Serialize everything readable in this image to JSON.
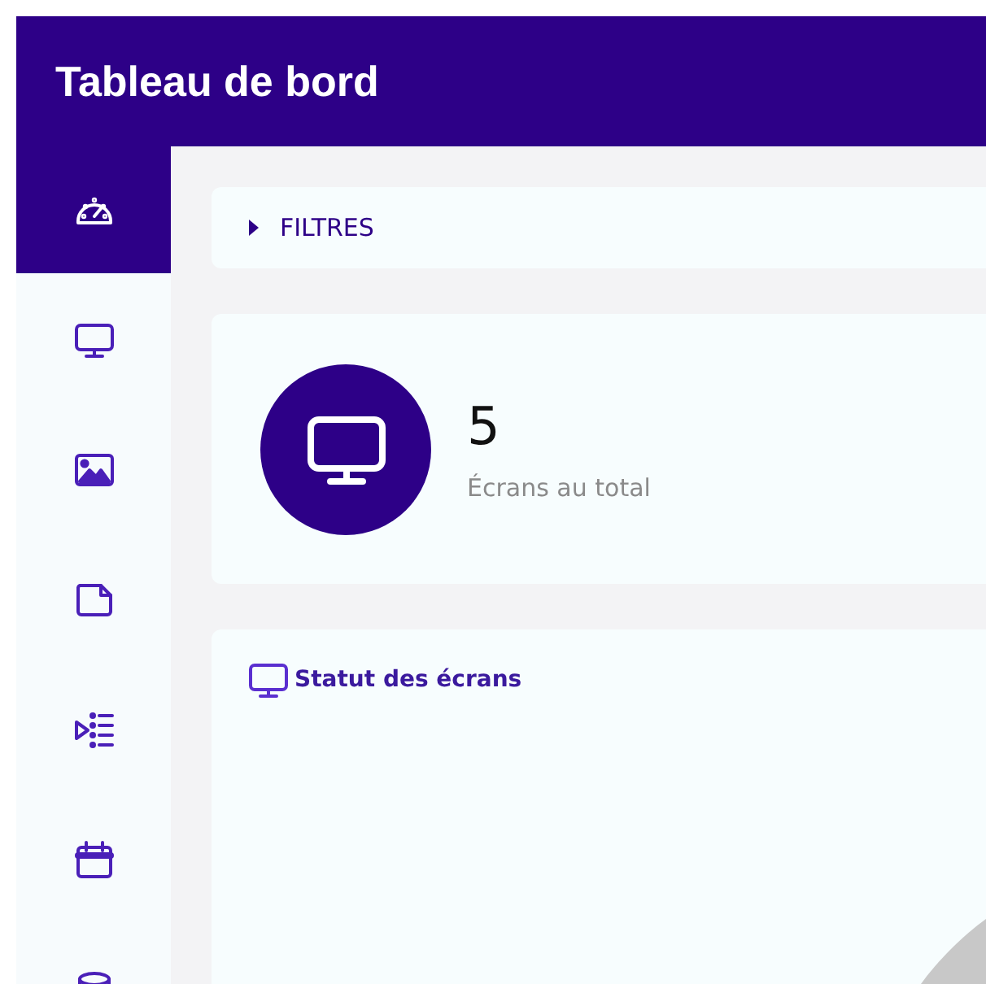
{
  "header": {
    "title": "Tableau de bord"
  },
  "sidebar": {
    "items": [
      {
        "kind": "gauge",
        "selected": true
      },
      {
        "kind": "monitor",
        "selected": false
      },
      {
        "kind": "image",
        "selected": false
      },
      {
        "kind": "file",
        "selected": false
      },
      {
        "kind": "playlist",
        "selected": false
      },
      {
        "kind": "calendar",
        "selected": false
      },
      {
        "kind": "database",
        "selected": false
      }
    ]
  },
  "filters": {
    "label": "FILTRES",
    "expanded": false
  },
  "stat": {
    "value": "5",
    "label": "Écrans au total"
  },
  "status_panel": {
    "title": "Statut des écrans"
  }
}
